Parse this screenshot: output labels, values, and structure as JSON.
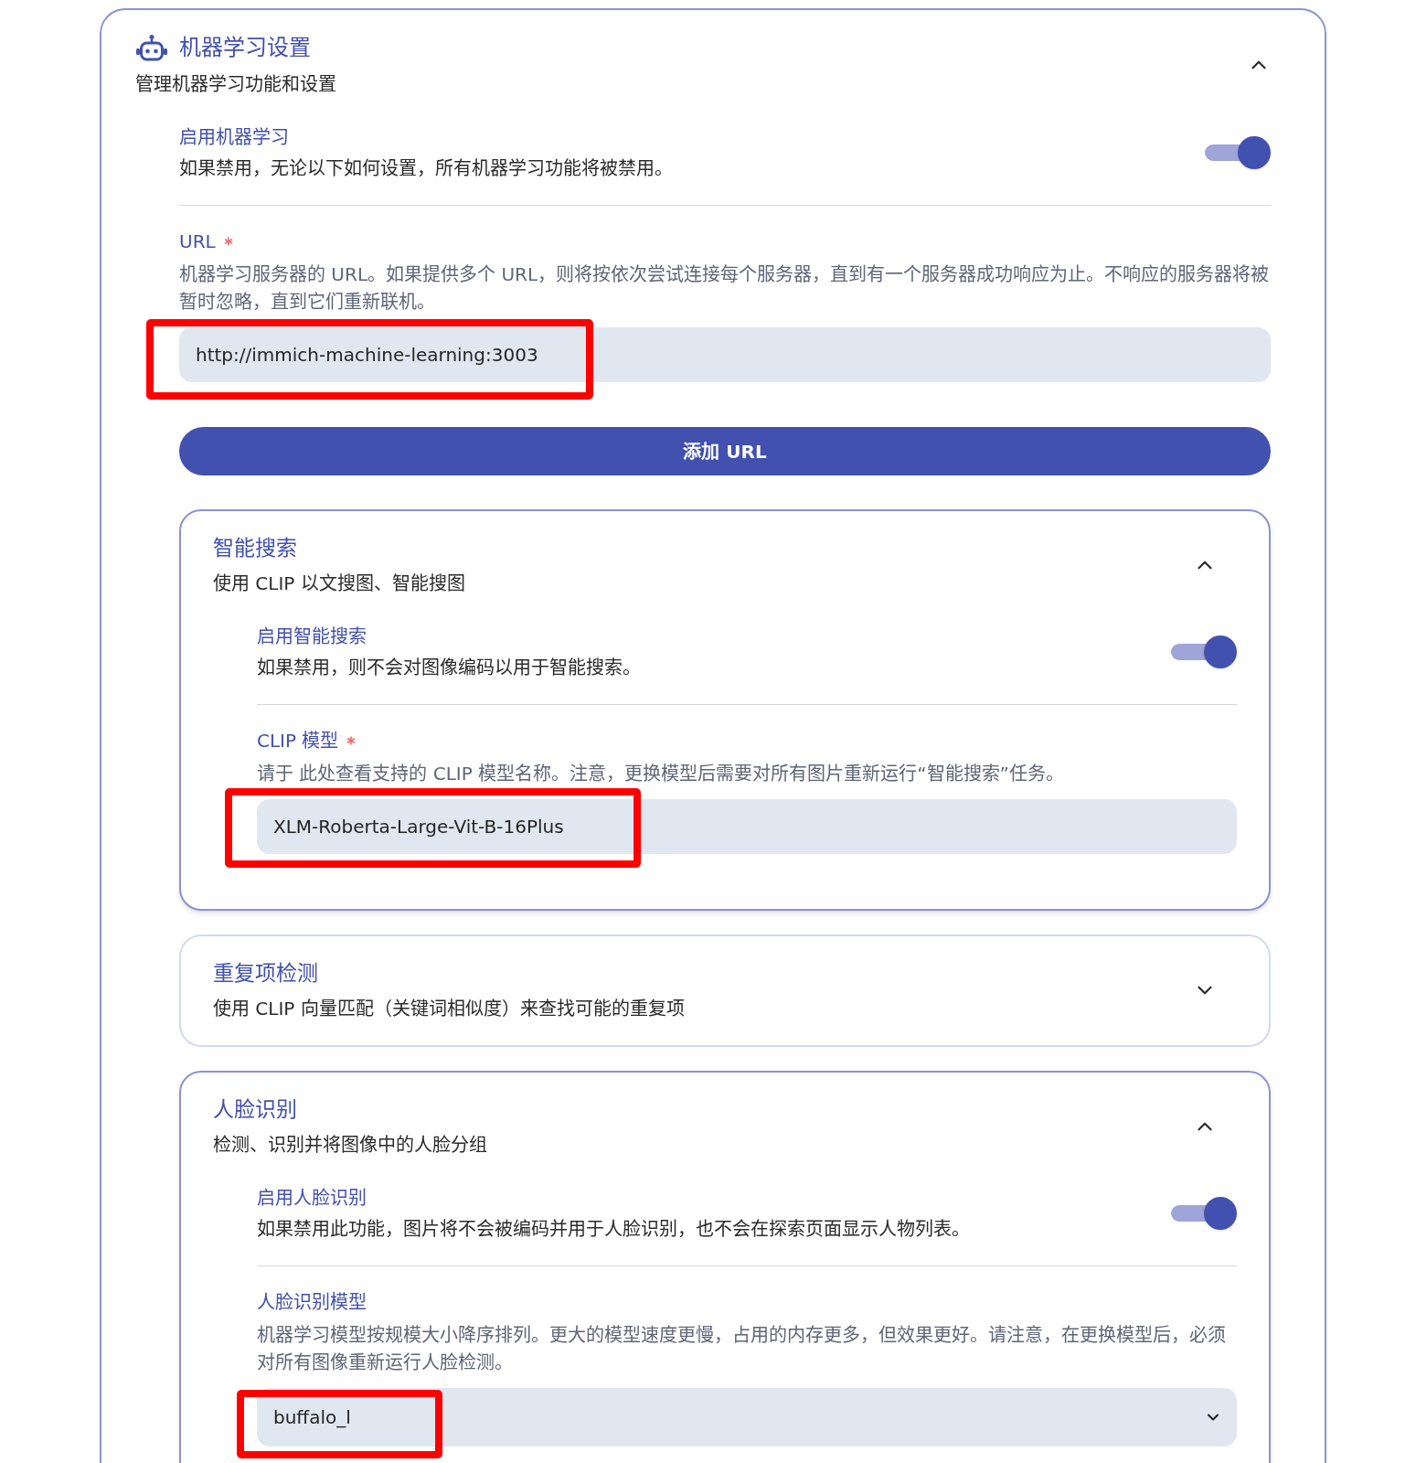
{
  "panel": {
    "title": "机器学习设置",
    "subtitle": "管理机器学习功能和设置",
    "expanded": true,
    "settings": [
      {
        "kind": "toggle",
        "label": "启用机器学习",
        "description": "如果禁用，无论以下如何设置，所有机器学习功能将被禁用。",
        "on": true
      },
      {
        "kind": "url_list",
        "label": "URL",
        "required": true,
        "description": "机器学习服务器的 URL。如果提供多个 URL，则将按依次尝试连接每个服务器，直到有一个服务器成功响应为止。不响应的服务器将被暂时忽略，直到它们重新联机。",
        "urls": [
          {
            "value": "http://immich-machine-learning:3003",
            "highlighted": true
          }
        ],
        "add_button": "添加 URL"
      }
    ],
    "sections": [
      {
        "title": "智能搜索",
        "subtitle": "使用 CLIP 以文搜图、智能搜图",
        "expanded": true,
        "settings": [
          {
            "kind": "toggle",
            "label": "启用智能搜索",
            "description": "如果禁用，则不会对图像编码以用于智能搜索。",
            "on": true
          },
          {
            "kind": "text",
            "label": "CLIP 模型",
            "required": true,
            "description": "请于 此处查看支持的 CLIP 模型名称。注意，更换模型后需要对所有图片重新运行“智能搜索”任务。",
            "value": "XLM-Roberta-Large-Vit-B-16Plus",
            "highlighted": true
          }
        ]
      },
      {
        "title": "重复项检测",
        "subtitle": "使用 CLIP 向量匹配（关键词相似度）来查找可能的重复项",
        "expanded": false
      },
      {
        "title": "人脸识别",
        "subtitle": "检测、识别并将图像中的人脸分组",
        "expanded": true,
        "settings": [
          {
            "kind": "toggle",
            "label": "启用人脸识别",
            "description": "如果禁用此功能，图片将不会被编码并用于人脸识别，也不会在探索页面显示人物列表。",
            "on": true
          },
          {
            "kind": "select",
            "label": "人脸识别模型",
            "required": false,
            "description": "机器学习模型按规模大小降序排列。更大的模型速度更慢，占用的内存更多，但效果更好。请注意，在更换模型后，必须对所有图像重新运行人脸检测。",
            "value": "buffalo_l",
            "highlighted": true
          }
        ]
      }
    ]
  }
}
